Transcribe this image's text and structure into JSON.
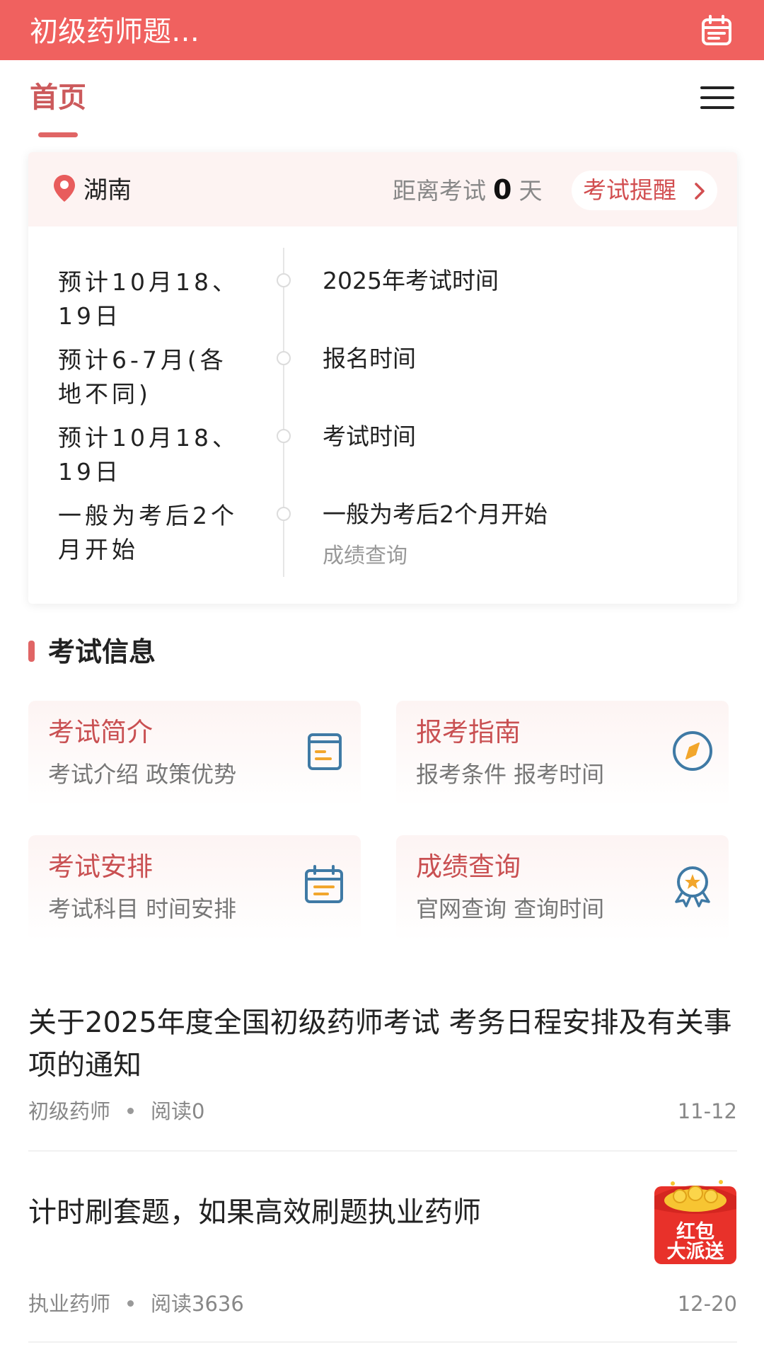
{
  "app_bar": {
    "title": "初级药师题…",
    "bg_color": "#f0615f",
    "calendar_icon": "calendar-icon"
  },
  "nav": {
    "home_label": "首页",
    "menu_icon": "hamburger-menu-icon"
  },
  "exam_card": {
    "region": "湖南",
    "countdown_prefix": "距离考试",
    "countdown_days": "0",
    "countdown_suffix": "天",
    "remind_label": "考试提醒",
    "timeline": [
      {
        "left": "预计10月18、19日",
        "right": "2025年考试时间",
        "sub": ""
      },
      {
        "left": "预计6-7月(各地不同)",
        "right": "报名时间",
        "sub": ""
      },
      {
        "left": "预计10月18、19日",
        "right": "考试时间",
        "sub": ""
      },
      {
        "left": "一般为考后2个月开始",
        "right": "一般为考后2个月开始",
        "sub": "成绩查询"
      }
    ]
  },
  "exam_info": {
    "title": "考试信息",
    "tiles": [
      {
        "title": "考试简介",
        "sub": "考试介绍 政策优势",
        "icon": "document-icon"
      },
      {
        "title": "报考指南",
        "sub": "报考条件 报考时间",
        "icon": "compass-icon"
      },
      {
        "title": "考试安排",
        "sub": "考试科目 时间安排",
        "icon": "calendar-icon"
      },
      {
        "title": "成绩查询",
        "sub": "官网查询 查询时间",
        "icon": "award-medal-icon"
      }
    ]
  },
  "articles": [
    {
      "title": "关于2025年度全国初级药师考试 考务日程安排及有关事项的通知",
      "category": "初级药师",
      "reads": "阅读0",
      "date": "11-12"
    },
    {
      "title": "计时刷套题，如果高效刷题执业药师",
      "category": "执业药师",
      "reads": "阅读3636",
      "date": "12-20",
      "promo": {
        "line1": "红包",
        "line2": "大派送"
      }
    }
  ]
}
